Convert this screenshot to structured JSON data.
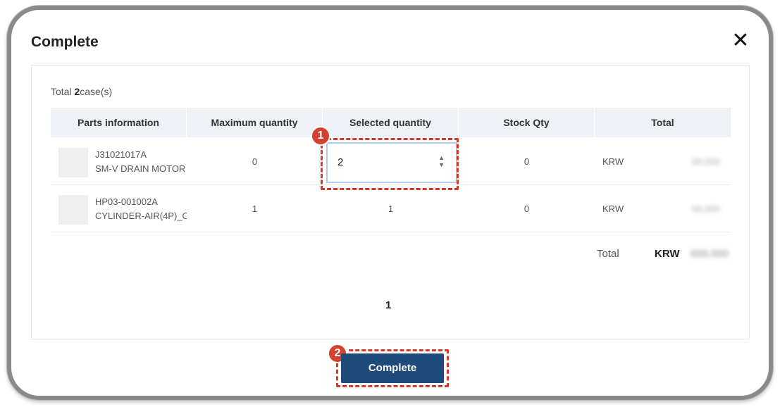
{
  "modal": {
    "title": "Complete",
    "close_glyph": "✕"
  },
  "summary": {
    "prefix": "Total",
    "count": "2",
    "suffix": "case(s)"
  },
  "table": {
    "columns": [
      "Parts information",
      "Maximum quantity",
      "Selected quantity",
      "Stock Qty",
      "Total"
    ],
    "rows": [
      {
        "code": "J31021017A",
        "name": "SM-V DRAIN MOTOR",
        "max_qty": "0",
        "selected_qty": "2",
        "stock_qty": "0",
        "currency": "KRW",
        "amount": "00,000"
      },
      {
        "code": "HP03-001002A",
        "name": "CYLINDER-AIR(4P)_C",
        "max_qty": "1",
        "selected_qty": "1",
        "stock_qty": "0",
        "currency": "KRW",
        "amount": "00,000"
      }
    ]
  },
  "grand_total": {
    "label": "Total",
    "currency": "KRW",
    "amount": "000,000"
  },
  "pagination": {
    "current_page": "1"
  },
  "actions": {
    "complete_label": "Complete"
  },
  "annotations": {
    "badge_1": "1",
    "badge_2": "2"
  },
  "colors": {
    "primary_button": "#1f4b7a",
    "highlight": "#d23a2c",
    "header_bg": "#eef2f6"
  }
}
